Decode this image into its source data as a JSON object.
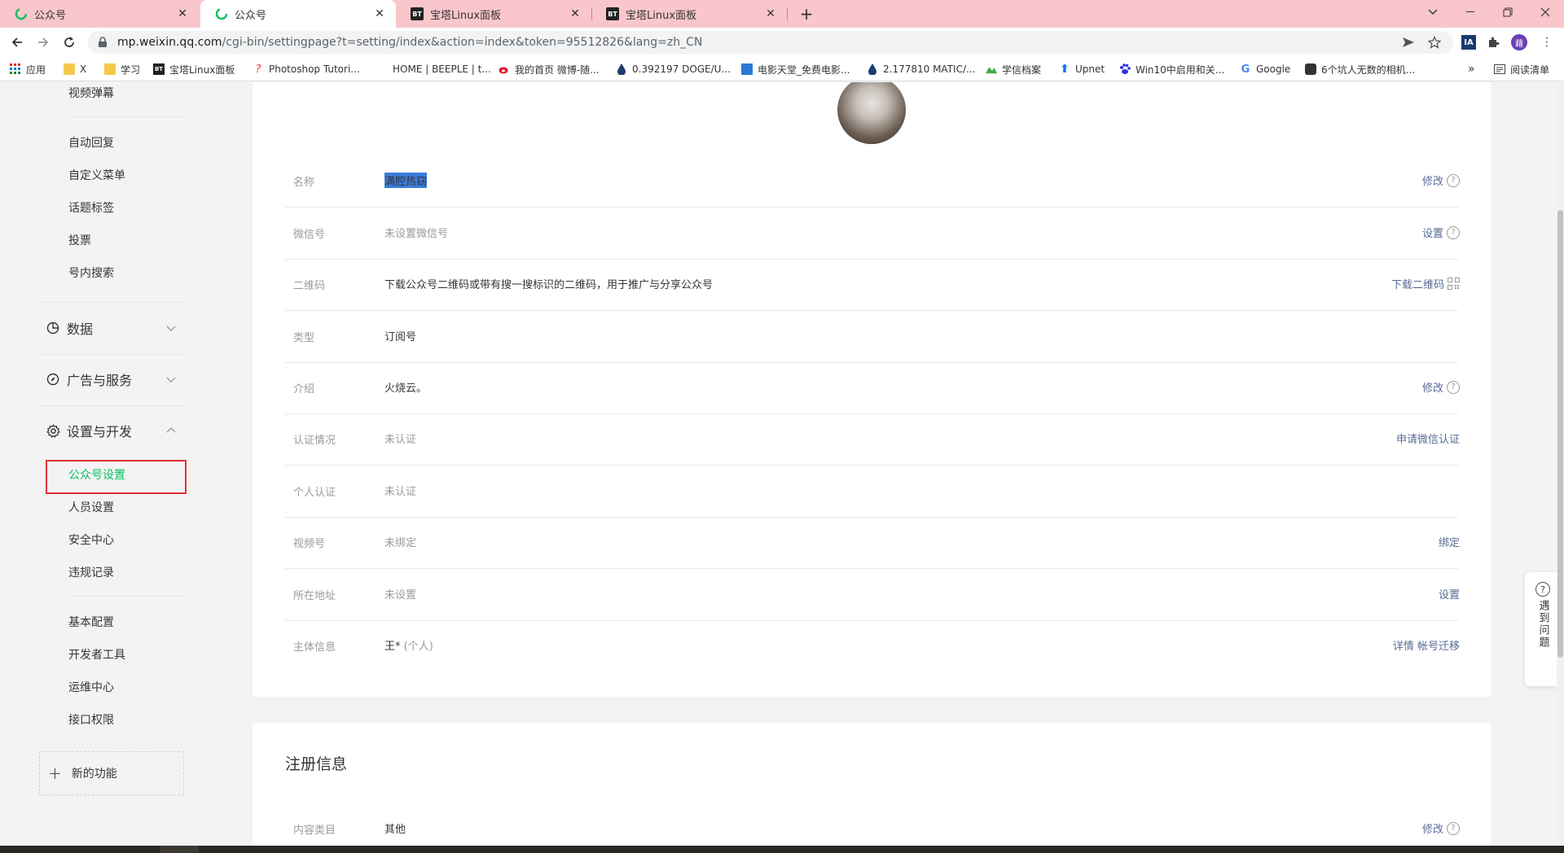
{
  "browser": {
    "tabs": [
      {
        "label": "公众号",
        "icon": "wechat-icon"
      },
      {
        "label": "公众号",
        "icon": "wechat-icon"
      },
      {
        "label": "宝塔Linux面板",
        "icon": "bt-icon"
      },
      {
        "label": "宝塔Linux面板",
        "icon": "bt-icon"
      }
    ],
    "bt_icon_text": "BT",
    "url_host": "mp.weixin.qq.com",
    "url_path": "/cgi-bin/settingpage?t=setting/index&action=index&token=95512826&lang=zh_CN",
    "ext_ia": "IA",
    "profile_initial": "藉",
    "bookmarks": [
      "应用",
      "X",
      "学习",
      "宝塔Linux面板",
      "Photoshop Tutori...",
      "HOME | BEEPLE | t...",
      "我的首页 微博-随...",
      "0.392197 DOGE/U...",
      "电影天堂_免费电影...",
      "2.177810 MATIC/...",
      "学信档案",
      "Upnet",
      "Win10中启用和关...",
      "Google",
      "6个坑人无数的相机...",
      "阅读清单"
    ],
    "more_bookmarks": "»"
  },
  "sidebar": {
    "top_items": [
      "视频弹幕",
      "自动回复",
      "自定义菜单",
      "话题标签",
      "投票",
      "号内搜索"
    ],
    "groups": [
      {
        "label": "数据",
        "expanded": false
      },
      {
        "label": "广告与服务",
        "expanded": false
      },
      {
        "label": "设置与开发",
        "expanded": true
      }
    ],
    "settings_items": [
      "公众号设置",
      "人员设置",
      "安全中心",
      "违规记录"
    ],
    "active_item": "公众号设置",
    "dev_items": [
      "基本配置",
      "开发者工具",
      "运维中心",
      "接口权限"
    ],
    "new_feature": "新的功能"
  },
  "account": {
    "rows": [
      {
        "label": "名称",
        "value": "满腔热窈",
        "action": "修改",
        "help": true,
        "selected": true
      },
      {
        "label": "微信号",
        "value": "未设置微信号",
        "muted": true,
        "action": "设置",
        "help": true
      },
      {
        "label": "二维码",
        "value": "下载公众号二维码或带有搜一搜标识的二维码，用于推广与分享公众号",
        "action": "下载二维码",
        "qr": true
      },
      {
        "label": "类型",
        "value": "订阅号"
      },
      {
        "label": "介绍",
        "value": "火烧云。",
        "action": "修改",
        "help": true
      },
      {
        "label": "认证情况",
        "value": "未认证",
        "muted": true,
        "action": "申请微信认证"
      },
      {
        "label": "个人认证",
        "value": "未认证",
        "muted": true
      },
      {
        "label": "视频号",
        "value": "未绑定",
        "muted": true,
        "action": "绑定"
      },
      {
        "label": "所在地址",
        "value": "未设置",
        "muted": true,
        "action": "设置"
      },
      {
        "label": "主体信息",
        "value": "王*",
        "value_suffix": "(个人)",
        "action": "详情",
        "action2": "帐号迁移"
      }
    ]
  },
  "registration": {
    "title": "注册信息",
    "row": {
      "label": "内容类目",
      "value": "其他",
      "action": "修改"
    }
  },
  "help_widget": {
    "text": "遇到问题"
  },
  "colors": {
    "accent_green": "#07c160",
    "link_blue": "#576b95",
    "tab_strip": "#f9c6cc",
    "highlight_red": "#e0303a",
    "selection_blue": "#3b7ddd"
  }
}
